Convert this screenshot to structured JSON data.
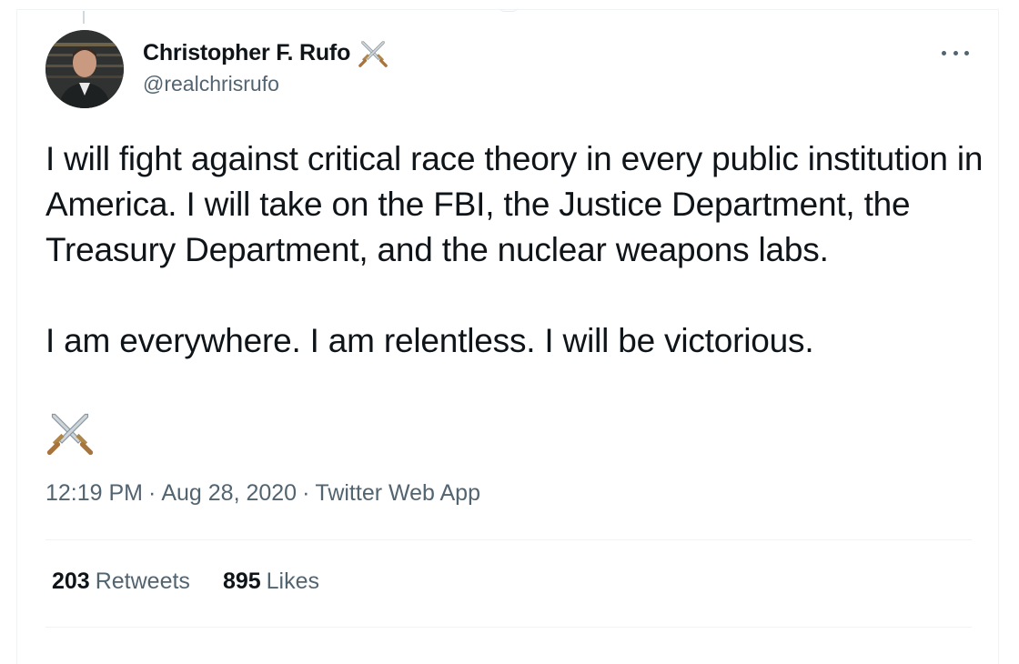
{
  "author": {
    "display_name": "Christopher F. Rufo",
    "handle": "@realchrisrufo",
    "badge_icon": "crossed-swords-icon"
  },
  "tweet": {
    "paragraphs": [
      "I will fight against critical race theory in every public institution in America. I will take on the FBI, the Justice Department, the Treasury Department, and the nuclear weapons labs.",
      "I am everywhere. I am relentless. I will be victorious."
    ],
    "trailing_emoji": "crossed-swords-icon"
  },
  "meta": {
    "time": "12:19 PM",
    "date": "Aug 28, 2020",
    "separator": "·",
    "source": "Twitter Web App"
  },
  "stats": {
    "retweets_count": "203",
    "retweets_label": "Retweets",
    "likes_count": "895",
    "likes_label": "Likes"
  },
  "colors": {
    "primary_text": "#0f1419",
    "secondary_text": "#536471",
    "divider": "#eff3f4"
  }
}
